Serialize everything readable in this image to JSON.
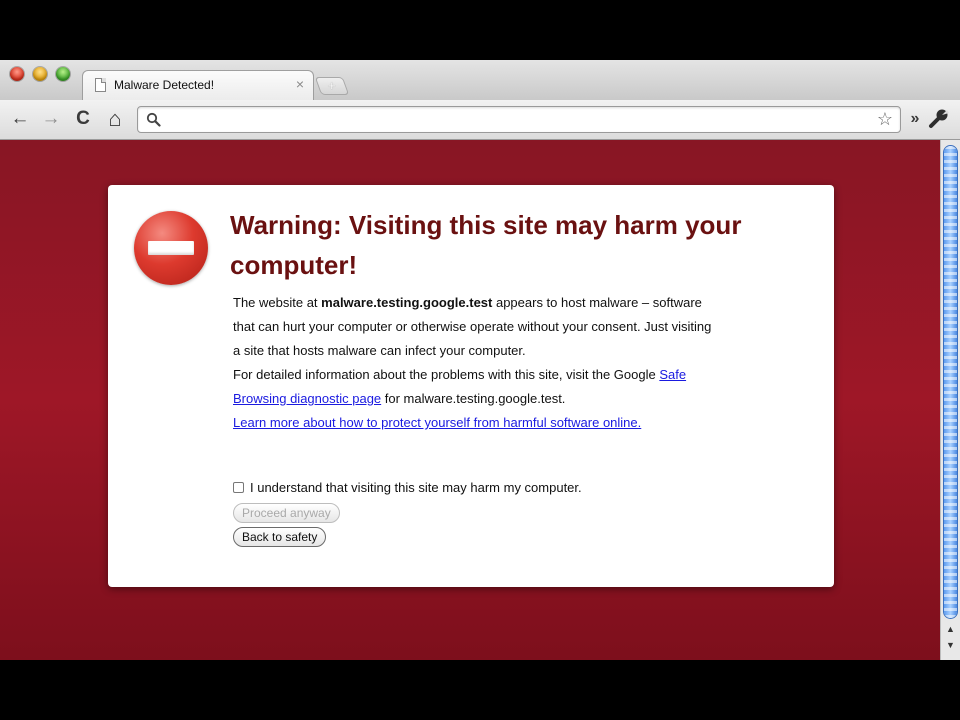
{
  "tab": {
    "title": "Malware Detected!",
    "close": "×"
  },
  "newtab": {
    "label": "+"
  },
  "toolbar": {
    "back": "←",
    "forward": "→",
    "reload": "C",
    "home": "⌂",
    "url_value": "",
    "star": "☆",
    "overflow": "»"
  },
  "page": {
    "headline": "Warning: Visiting this site may harm your computer!",
    "p1_prefix": "The website at ",
    "p1_domain": "malware.testing.google.test",
    "p1_suffix": " appears to host malware – software that can hurt your computer or otherwise operate without your consent. Just visiting a site that hosts malware can infect your computer.",
    "p2_prefix": "For detailed information about the problems with this site, visit the Google ",
    "p2_link": "Safe Browsing diagnostic page",
    "p2_suffix": " for malware.testing.google.test.",
    "learn_more_link": "Learn more about how to protect yourself from harmful software online.",
    "checkbox_label": "I understand that visiting this site may harm my computer.",
    "checkbox_checked": false,
    "proceed_button": "Proceed anyway",
    "back_button": "Back to safety"
  },
  "colors": {
    "background": "#9e1727",
    "headline": "#6a1111",
    "link": "#1a1ae0"
  }
}
